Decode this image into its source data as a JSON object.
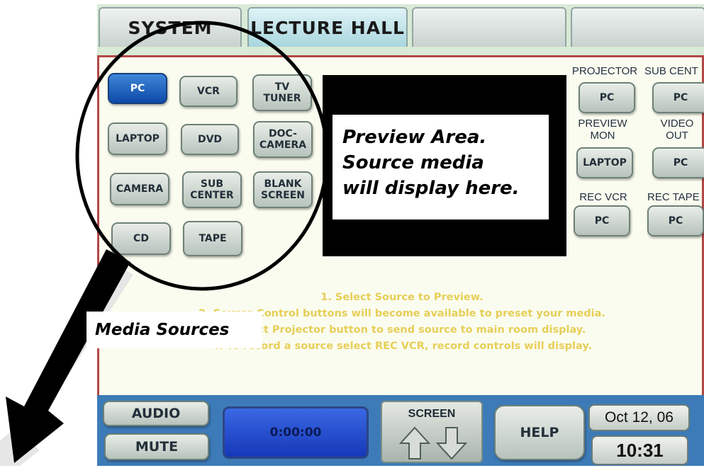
{
  "tabs": [
    {
      "label": "SYSTEM"
    },
    {
      "label": "LECTURE HALL"
    },
    {
      "label": ""
    },
    {
      "label": ""
    }
  ],
  "sources": [
    {
      "label": "PC",
      "selected": true
    },
    {
      "label": "VCR"
    },
    {
      "label": "TV\nTUNER"
    },
    {
      "label": "LAPTOP"
    },
    {
      "label": "DVD"
    },
    {
      "label": "DOC-\nCAMERA"
    },
    {
      "label": "CAMERA"
    },
    {
      "label": "SUB\nCENTER"
    },
    {
      "label": "BLANK\nSCREEN"
    },
    {
      "label": "CD"
    },
    {
      "label": "TAPE"
    }
  ],
  "routing": [
    {
      "label": "PROJECTOR",
      "value": "PC"
    },
    {
      "label": "SUB CENT",
      "value": "PC"
    },
    {
      "label": "PREVIEW\nMON",
      "value": "LAPTOP"
    },
    {
      "label": "VIDEO\nOUT",
      "value": "PC"
    },
    {
      "label": "REC VCR",
      "value": "PC"
    },
    {
      "label": "REC TAPE",
      "value": "PC"
    }
  ],
  "instructions": "1. Select Source to Preview.\n2. Source Control buttons will become available to preset your media.\n3. Select Projector button to send source to main room display.\n4. To record a source select REC VCR, record controls will display.",
  "bottom": {
    "audio": "AUDIO",
    "mute": "MUTE",
    "timer": "0:00:00",
    "screen": "SCREEN",
    "help": "HELP",
    "date": "Oct 12, 06",
    "time": "10:31"
  },
  "annotations": {
    "preview": "Preview Area.\nSource media\nwill display here.",
    "media": "Media Sources"
  },
  "colors": {
    "selected_button": "#0c4aa8",
    "accent_border": "#b34747",
    "bottom_bar": "#3d7bb8",
    "instruction_text": "#e7ce58"
  }
}
